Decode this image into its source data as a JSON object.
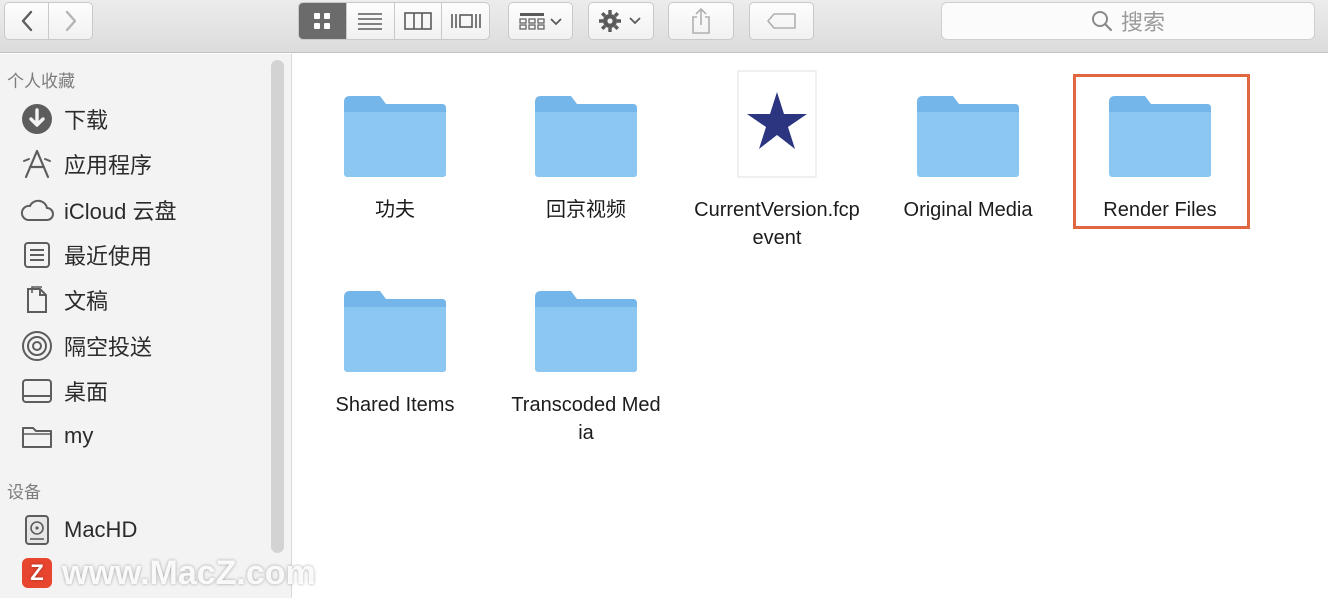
{
  "toolbar": {
    "back_icon": "chevron-left-icon",
    "forward_icon": "chevron-right-icon",
    "views": [
      "icon-view",
      "list-view",
      "column-view",
      "gallery-view"
    ],
    "search_placeholder": "搜索"
  },
  "sidebar": {
    "favorites_title": "个人收藏",
    "favorites": [
      {
        "label": "下载",
        "icon": "download-icon"
      },
      {
        "label": "应用程序",
        "icon": "applications-icon"
      },
      {
        "label": "iCloud 云盘",
        "icon": "cloud-icon"
      },
      {
        "label": "最近使用",
        "icon": "recents-icon"
      },
      {
        "label": "文稿",
        "icon": "documents-icon"
      },
      {
        "label": "隔空投送",
        "icon": "airdrop-icon"
      },
      {
        "label": "桌面",
        "icon": "desktop-icon"
      },
      {
        "label": "my",
        "icon": "folder-icon"
      }
    ],
    "devices_title": "设备",
    "devices": [
      {
        "label": "MacHD",
        "icon": "harddisk-icon"
      }
    ]
  },
  "files": [
    {
      "name": "功夫",
      "type": "folder"
    },
    {
      "name": "回京视频",
      "type": "folder"
    },
    {
      "name": "CurrentVersion.fcpevent",
      "type": "document"
    },
    {
      "name": "Original Media",
      "type": "folder"
    },
    {
      "name": "Render Files",
      "type": "folder",
      "highlighted": true
    },
    {
      "name": "Shared Items",
      "type": "folder"
    },
    {
      "name": "Transcoded Media",
      "type": "folder"
    }
  ],
  "watermark": {
    "logo": "Z",
    "text": "www.MacZ.com"
  },
  "colors": {
    "folder": "#8cc7f2",
    "highlight": "#e0673f",
    "star": "#2b3580"
  }
}
